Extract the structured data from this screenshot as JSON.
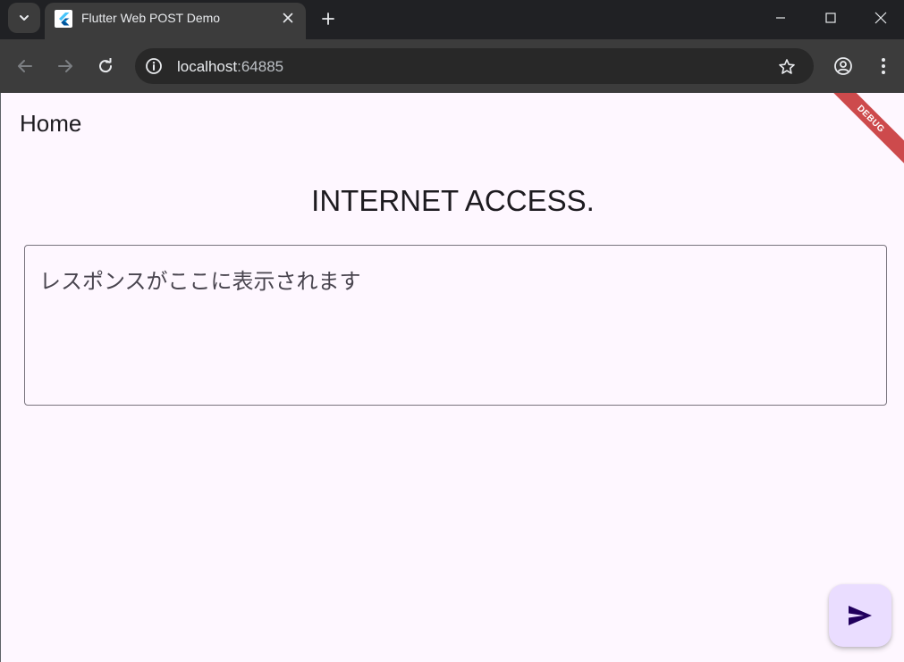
{
  "browser": {
    "tab": {
      "title": "Flutter Web POST Demo"
    },
    "tab_search_icon": "chevron-down-icon",
    "address": {
      "host": "localhost",
      "port": ":64885"
    },
    "colors": {
      "frame": "#202124",
      "toolbar": "#3c3c3c",
      "omnibox": "#282828"
    }
  },
  "app": {
    "appbar": {
      "title": "Home"
    },
    "debug_banner": "DEBUG",
    "heading": "INTERNET ACCESS.",
    "response_box": {
      "placeholder": "レスポンスがここに表示されます"
    },
    "fab_icon": "send-icon",
    "colors": {
      "background": "#fef7ff",
      "fab": "#eaddff",
      "fab_icon": "#21005d",
      "border": "#79747e"
    }
  }
}
